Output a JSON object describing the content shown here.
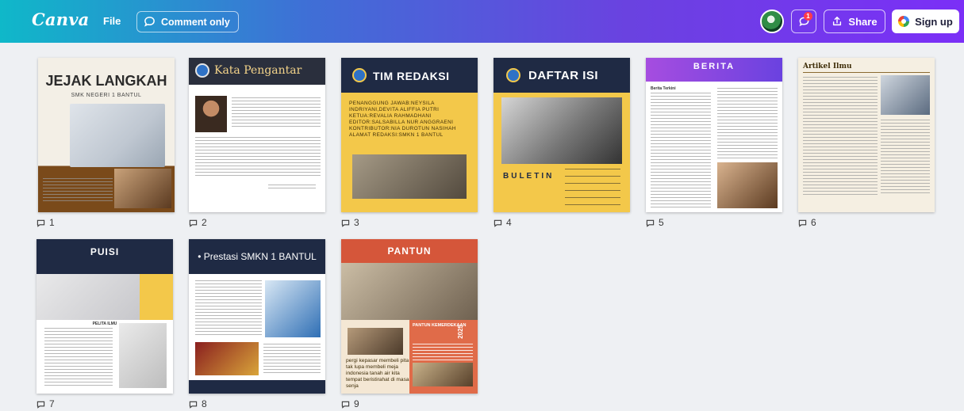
{
  "header": {
    "logo": "Canva",
    "file_label": "File",
    "comment_label": "Comment only",
    "notification_count": "1",
    "share_label": "Share",
    "signup_label": "Sign up"
  },
  "pages": [
    {
      "number": "1",
      "title": "JEJAK LANGKAH",
      "subtitle": "SMK NEGERI 1 BANTUL"
    },
    {
      "number": "2",
      "title": "Kata Pengantar"
    },
    {
      "number": "3",
      "title": "TIM REDAKSI",
      "body": "PENANGGUNG JAWAB:NEYSILA INDRIYANI,DEVITA ALIFFIA PUTRI KETUA:REVALIA RAHMADHANI EDITOR:SALSABILLA NUR ANGGRAENI KONTRIBUTOR:NIA DUROTUN NASIHAH ALAMAT REDAKSI:SMKN 1 BANTUL"
    },
    {
      "number": "4",
      "title": "DAFTAR ISI",
      "footer": "BULETIN"
    },
    {
      "number": "5",
      "title": "BERITA",
      "heading": "Berita Terkini"
    },
    {
      "number": "6",
      "title": "Artikel Ilmu"
    },
    {
      "number": "7",
      "title": "PUISI",
      "caption": "PELITA ILMU"
    },
    {
      "number": "8",
      "title": "• Prestasi SMKN 1 BANTUL"
    },
    {
      "number": "9",
      "title": "PANTUN",
      "tag": "PANTUN KEMERDEKAAN",
      "year": "2025",
      "body": "pergi kepasar membeli pita tak lupa membeli meja indonesia tanah air kita tempat beristirahat di masa senja"
    }
  ]
}
